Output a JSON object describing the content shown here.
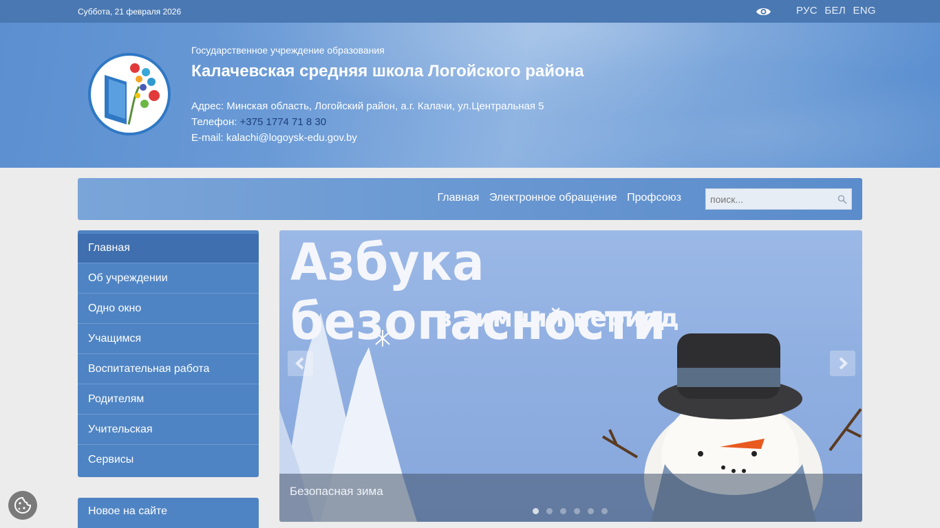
{
  "topbar": {
    "date": "Суббота, 21 февраля 2026",
    "languages": [
      "РУС",
      "БЕЛ",
      "ENG"
    ]
  },
  "header": {
    "subtitle": "Государственное учреждение образования",
    "title": "Калачевская средняя школа Логойского района",
    "address": "Адрес: Минская область, Логойский район, а.г. Калачи, ул.Центральная 5",
    "phone_label": "Телефон: ",
    "phone_number": "+375 1774 71 8 30",
    "email": "E-mail: kalachi@logoysk-edu.gov.by"
  },
  "nav": {
    "links": [
      "Главная",
      "Электронное обращение",
      "Профсоюз"
    ],
    "search_placeholder": "поиск..."
  },
  "sidebar": {
    "items": [
      {
        "label": "Главная",
        "active": true
      },
      {
        "label": "Об учреждении"
      },
      {
        "label": "Одно окно"
      },
      {
        "label": "Учащимся"
      },
      {
        "label": "Воспитательная работа"
      },
      {
        "label": "Родителям"
      },
      {
        "label": "Учительская"
      },
      {
        "label": "Сервисы"
      }
    ],
    "news_title": "Новое на сайте"
  },
  "slider": {
    "heading": "Азбука безопасности",
    "subheading": "в зимний период",
    "caption": "Безопасная зима",
    "dot_count": 6,
    "active_dot": 0
  },
  "colors": {
    "topbar": "#4a78b2",
    "header": "#5b8fd0",
    "sidebar": "#4f84c4",
    "sidebar_active": "#3f6fae"
  }
}
